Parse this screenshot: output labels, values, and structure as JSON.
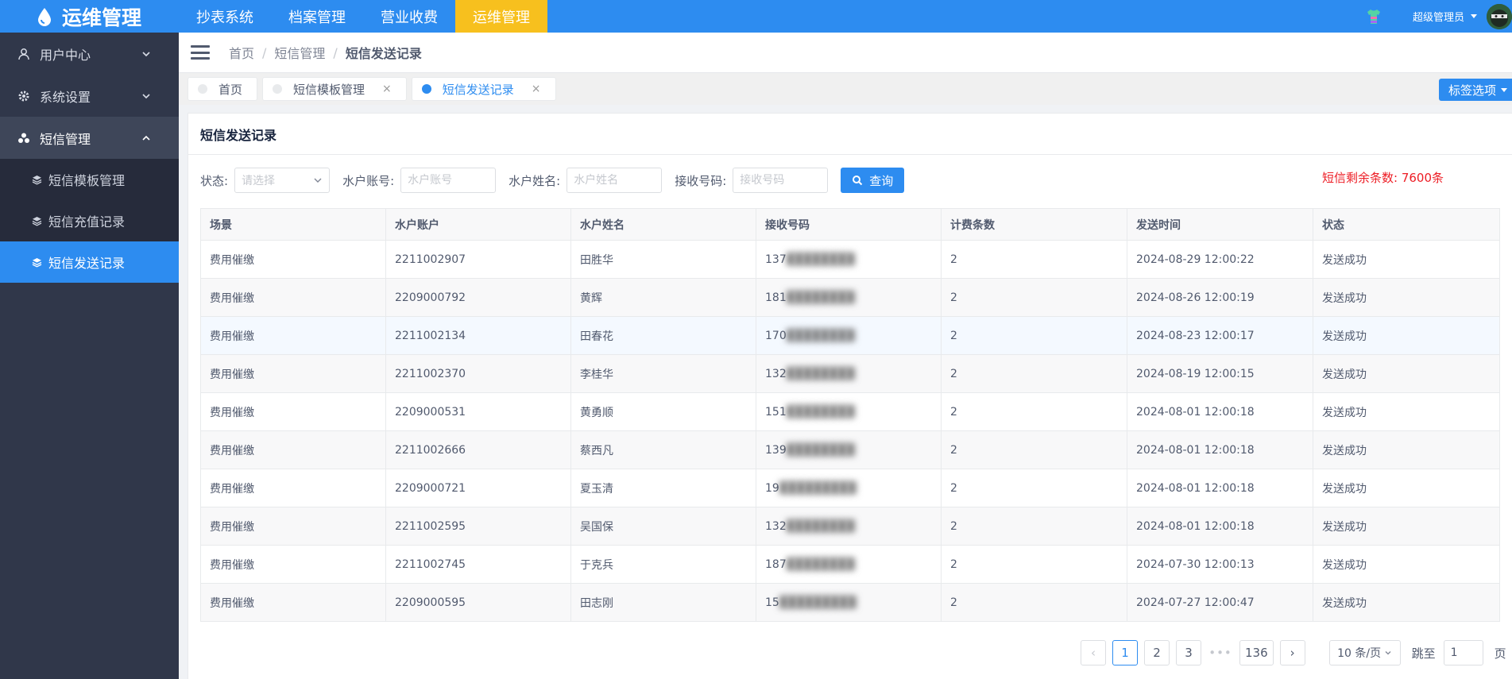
{
  "app": {
    "logo_text": "运维管理"
  },
  "topnav": {
    "items": [
      "抄表系统",
      "档案管理",
      "营业收费",
      "运维管理"
    ],
    "user_name": "超级管理员"
  },
  "sidebar": {
    "groups": [
      {
        "label": "用户中心",
        "icon": "user-icon"
      },
      {
        "label": "系统设置",
        "icon": "gear-icon"
      },
      {
        "label": "短信管理",
        "icon": "cluster-icon"
      }
    ],
    "subitems": [
      "短信模板管理",
      "短信充值记录",
      "短信发送记录"
    ]
  },
  "breadcrumb": [
    "首页",
    "短信管理",
    "短信发送记录"
  ],
  "tabs": [
    {
      "label": "首页"
    },
    {
      "label": "短信模板管理",
      "close": "×"
    },
    {
      "label": "短信发送记录",
      "close": "×"
    }
  ],
  "tab_options_label": "标签选项",
  "card_title": "短信发送记录",
  "filters": {
    "status_label": "状态:",
    "status_placeholder": "请选择",
    "account_label": "水户账号:",
    "account_placeholder": "水户账号",
    "name_label": "水户姓名:",
    "name_placeholder": "水户姓名",
    "phone_label": "接收号码:",
    "phone_placeholder": "接收号码",
    "query_label": "查询"
  },
  "sms_remaining": "短信剩余条数: 7600条",
  "table": {
    "columns": [
      "场景",
      "水户账户",
      "水户姓名",
      "接收号码",
      "计费条数",
      "发送时间",
      "状态"
    ],
    "rows": [
      [
        "费用催缴",
        "2211002907",
        "田胜华",
        "137",
        "2",
        "2024-08-29 12:00:22",
        "发送成功"
      ],
      [
        "费用催缴",
        "2209000792",
        "黄辉",
        "181",
        "2",
        "2024-08-26 12:00:19",
        "发送成功"
      ],
      [
        "费用催缴",
        "2211002134",
        "田春花",
        "170",
        "2",
        "2024-08-23 12:00:17",
        "发送成功"
      ],
      [
        "费用催缴",
        "2211002370",
        "李桂华",
        "132",
        "2",
        "2024-08-19 12:00:15",
        "发送成功"
      ],
      [
        "费用催缴",
        "2209000531",
        "黄勇顺",
        "151",
        "2",
        "2024-08-01 12:00:18",
        "发送成功"
      ],
      [
        "费用催缴",
        "2211002666",
        "蔡西凡",
        "139",
        "2",
        "2024-08-01 12:00:18",
        "发送成功"
      ],
      [
        "费用催缴",
        "2209000721",
        "夏玉清",
        "19",
        "2",
        "2024-08-01 12:00:18",
        "发送成功"
      ],
      [
        "费用催缴",
        "2211002595",
        "吴国保",
        "132",
        "2",
        "2024-08-01 12:00:18",
        "发送成功"
      ],
      [
        "费用催缴",
        "2211002745",
        "于克兵",
        "187",
        "2",
        "2024-07-30 12:00:13",
        "发送成功"
      ],
      [
        "费用催缴",
        "2209000595",
        "田志刚",
        "15",
        "2",
        "2024-07-27 12:00:47",
        "发送成功"
      ]
    ]
  },
  "pagination": {
    "prev": "‹",
    "pages": [
      "1",
      "2",
      "3"
    ],
    "dots": "•••",
    "last_page": "136",
    "next": "›",
    "page_size": "10 条/页",
    "jump_label": "跳至",
    "jump_value": "1",
    "page_suffix": "页"
  },
  "colors": {
    "primary": "#2d8cf0",
    "active_nav": "#f7c01e",
    "sidebar": "#30374a",
    "alert": "#ed1c24"
  }
}
